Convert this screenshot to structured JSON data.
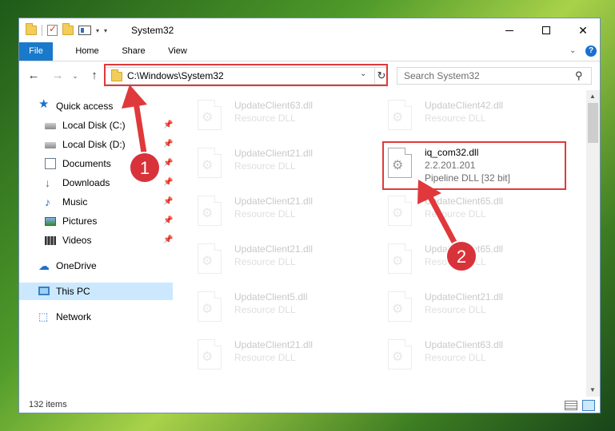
{
  "window": {
    "title": "System32"
  },
  "title_controls": {
    "minimize_icon": "minimize-icon",
    "maximize_icon": "maximize-icon",
    "close_label": "✕"
  },
  "ribbon": {
    "tabs": [
      "File",
      "Home",
      "Share",
      "View"
    ],
    "collapse_glyph": "⌄",
    "help_label": "?"
  },
  "nav": {
    "back_glyph": "←",
    "forward_glyph": "→",
    "recent_glyph": "⌄",
    "up_glyph": "↑",
    "address": "C:\\Windows\\System32",
    "address_drop_glyph": "⌄",
    "refresh_glyph": "↻",
    "search_placeholder": "Search System32",
    "search_glyph": "⚲"
  },
  "sidebar": {
    "items": [
      {
        "label": "Quick access",
        "icon": "star-icon",
        "glyph": "★"
      },
      {
        "label": "Local Disk (C:)",
        "icon": "drive-icon",
        "pinned": true
      },
      {
        "label": "Local Disk (D:)",
        "icon": "drive-icon",
        "pinned": true
      },
      {
        "label": "Documents",
        "icon": "documents-icon",
        "pinned": true
      },
      {
        "label": "Downloads",
        "icon": "downloads-icon",
        "glyph": "↓",
        "pinned": true
      },
      {
        "label": "Music",
        "icon": "music-icon",
        "glyph": "♪",
        "pinned": true
      },
      {
        "label": "Pictures",
        "icon": "pictures-icon",
        "pinned": true
      },
      {
        "label": "Videos",
        "icon": "videos-icon",
        "pinned": true
      },
      {
        "label": "OneDrive",
        "icon": "cloud-icon",
        "glyph": "☁"
      },
      {
        "label": "This PC",
        "icon": "computer-icon",
        "selected": true
      },
      {
        "label": "Network",
        "icon": "network-icon",
        "glyph": "⬚"
      }
    ],
    "pin_glyph": "📌"
  },
  "files": [
    {
      "name": "UpdateClient63.dll",
      "type": "Resource DLL"
    },
    {
      "name": "UpdateClient42.dll",
      "type": "Resource DLL"
    },
    {
      "name": "UpdateClient21.dll",
      "type": "Resource DLL"
    },
    {
      "name": "iq_com32.dll",
      "version": "2.2.201.201",
      "type": "Pipeline DLL [32 bit]"
    },
    {
      "name": "UpdateClient21.dll",
      "type": "Resource DLL"
    },
    {
      "name": "UpdateClient65.dll",
      "type": "Resource DLL"
    },
    {
      "name": "UpdateClient21.dll",
      "type": "Resource DLL"
    },
    {
      "name": "UpdateClient65.dll",
      "type": "Resource DLL"
    },
    {
      "name": "UpdateClient5.dll",
      "type": "Resource DLL"
    },
    {
      "name": "UpdateClient21.dll",
      "type": "Resource DLL"
    },
    {
      "name": "UpdateClient21.dll",
      "type": "Resource DLL"
    },
    {
      "name": "UpdateClient63.dll",
      "type": "Resource DLL"
    }
  ],
  "file_icon_glyph": "⚙",
  "scrollbar": {
    "up_glyph": "▲",
    "down_glyph": "▼"
  },
  "status": {
    "item_count": "132 items"
  },
  "annotations": {
    "badge_1": "1",
    "badge_2": "2",
    "color": "#e0393b"
  }
}
